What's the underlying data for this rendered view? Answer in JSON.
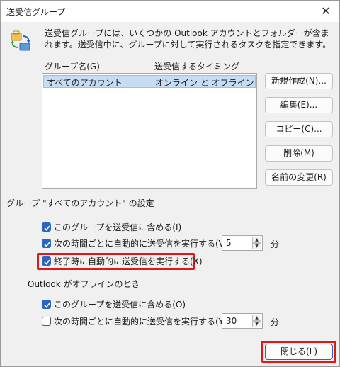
{
  "window": {
    "title": "送受信グループ",
    "close_icon": "close-icon"
  },
  "intro": {
    "icon": "send-receive-groups-icon",
    "text": "送受信グループには、いくつかの Outlook アカウントとフォルダーが含まれます。送受信中に、グループに対して実行されるタスクを指定できます。"
  },
  "list": {
    "columns": [
      "グループ名(G)",
      "送受信するタイミング"
    ],
    "rows": [
      {
        "name": "すべてのアカウント",
        "timing": "オンライン と オフライン",
        "selected": true
      }
    ]
  },
  "side_buttons": [
    "新規作成(N)...",
    "編集(E)...",
    "コピー(C)...",
    "削除(M)",
    "名前の変更(R)"
  ],
  "group_settings": {
    "heading": "グループ \"すべてのアカウント\" の設定",
    "online": {
      "include_label": "このグループを送受信に含める(I)",
      "include_checked": true,
      "schedule_label": "次の時間ごとに自動的に送受信を実行する(V)",
      "schedule_checked": true,
      "schedule_value": "5",
      "schedule_unit": "分",
      "on_exit_label": "終了時に自動的に送受信を実行する(X)",
      "on_exit_checked": true
    },
    "offline": {
      "heading": "Outlook がオフラインのとき",
      "include_label": "このグループを送受信に含める(O)",
      "include_checked": true,
      "schedule_label": "次の時間ごとに自動的に送受信を実行する(Y)",
      "schedule_checked": false,
      "schedule_value": "30",
      "schedule_unit": "分"
    }
  },
  "close_button_label": "閉じる(L)",
  "colors": {
    "accent": "#2a66c0",
    "highlight_red": "#e01818",
    "selection": "#c6dcf2"
  }
}
